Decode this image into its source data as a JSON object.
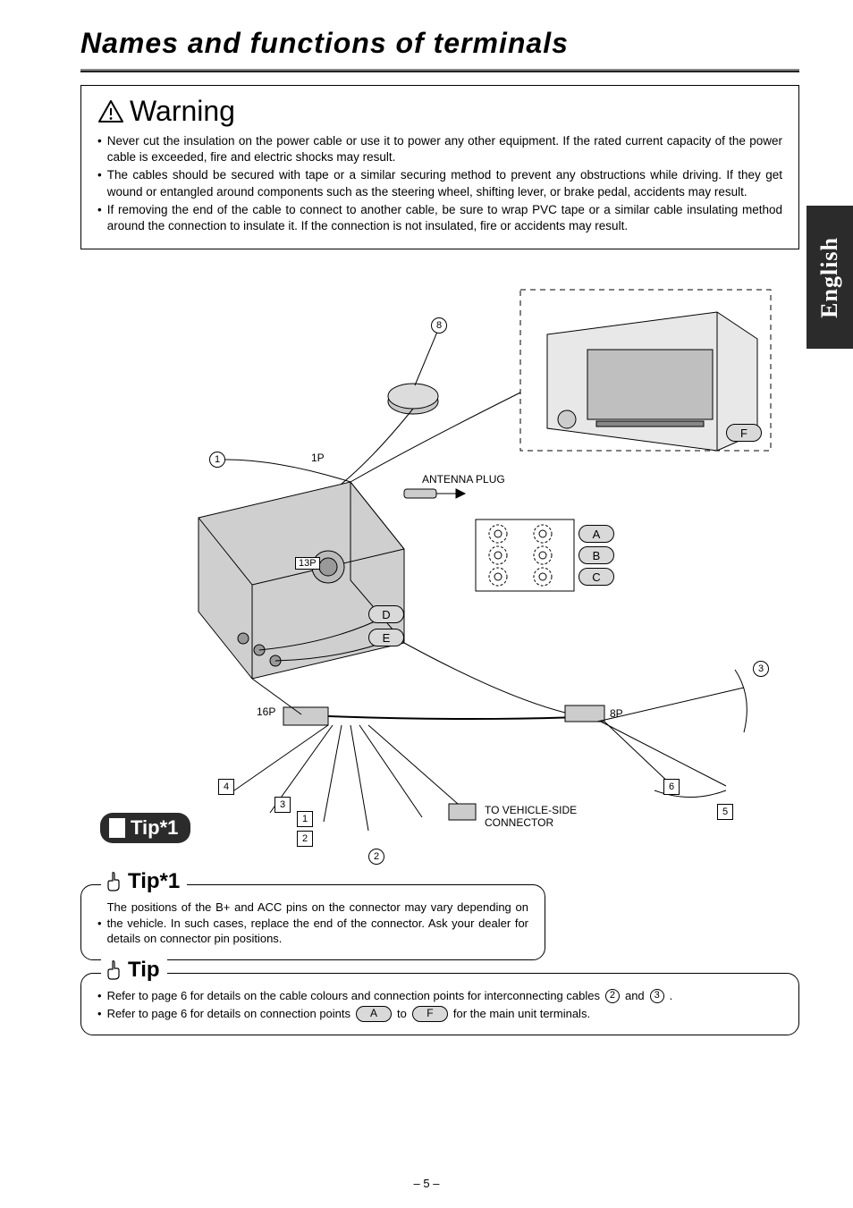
{
  "title": "Names and functions of terminals",
  "language_tab": "English",
  "warning": {
    "heading": "Warning",
    "items": [
      "Never cut the insulation on the power cable or use it to power any other equipment. If the rated current capacity of the power cable is exceeded, fire and electric shocks may result.",
      "The cables should be secured with tape or a similar securing method to prevent any obstructions while driving. If they get wound or entangled around components such as the steering wheel, shifting lever, or brake pedal, accidents may result.",
      "If removing the end of the cable to connect to another cable, be sure to wrap PVC tape or a similar cable insulating method around the connection to insulate it. If the connection is not insulated, fire or accidents may result."
    ]
  },
  "diagram": {
    "circled_callouts": [
      "1",
      "2",
      "3",
      "8"
    ],
    "square_callouts": [
      "1",
      "2",
      "3",
      "4",
      "5",
      "6"
    ],
    "pill_callouts": [
      "A",
      "B",
      "C",
      "D",
      "E",
      "F"
    ],
    "labels": {
      "p1": "1P",
      "p13": "13P",
      "p16": "16P",
      "p8": "8P",
      "antenna": "ANTENNA PLUG",
      "vehicle_side": "TO VEHICLE-SIDE CONNECTOR"
    },
    "tip_badge": "Tip*1"
  },
  "tip1_box": {
    "legend": "Tip*1",
    "body": "The positions of the B+ and ACC pins on the connector may vary depending on the vehicle. In such cases, replace the end of the connector. Ask your dealer for details on connector pin positions."
  },
  "tip_box": {
    "legend": "Tip",
    "line1_a": "Refer to page 6 for details on the cable colours and connection points for interconnecting cables",
    "line1_b": "and",
    "line1_c": ".",
    "ref2": "2",
    "ref3": "3",
    "line2_a": "Refer to page 6 for details on connection points",
    "line2_b": "to",
    "line2_c": "for the main unit terminals.",
    "refA": "A",
    "refF": "F"
  },
  "page_number": "– 5 –"
}
